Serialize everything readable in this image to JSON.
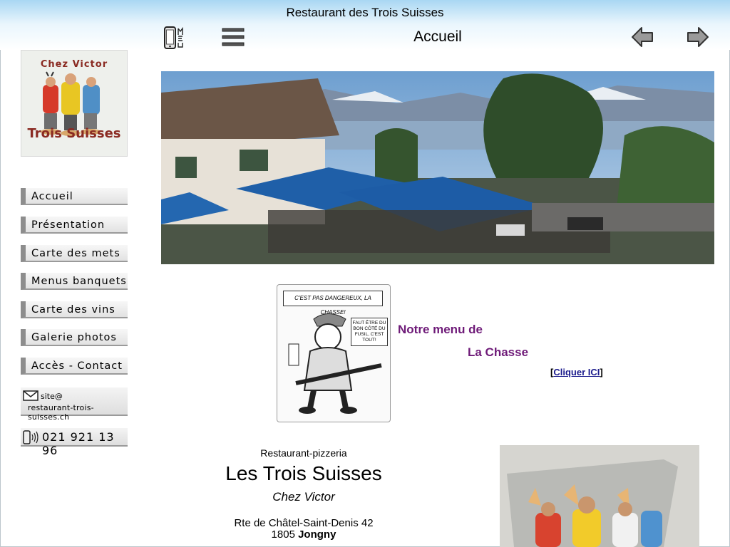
{
  "site_title": "Restaurant des Trois Suisses",
  "toolbar": {
    "page_heading": "Accueil"
  },
  "logo": {
    "line1": "Chez Victor",
    "line2": "Trois Suisses"
  },
  "nav": {
    "items": [
      {
        "label": "Accueil"
      },
      {
        "label": "Présentation"
      },
      {
        "label": "Carte des mets"
      },
      {
        "label": "Menus banquets"
      },
      {
        "label": "Carte des vins"
      },
      {
        "label": "Galerie photos"
      },
      {
        "label": "Accès - Contact"
      }
    ]
  },
  "contact": {
    "mail_line1": "site@",
    "mail_line2": "restaurant-trois-suisses.ch",
    "phone": "021 921 13 96"
  },
  "cartoon": {
    "quote": "C'EST PAS DANGEREUX, LA CHASSE!",
    "bubble": "FAUT ÊTRE DU BON CÔTÉ DU FUSIL, C'EST TOUT!"
  },
  "promo": {
    "line1": "Notre menu de",
    "line2": "La Chasse",
    "link_open": "[",
    "link_label": "Cliquer ICI",
    "link_close": "]"
  },
  "address": {
    "kind": "Restaurant-pizzeria",
    "name": "Les Trois Suisses",
    "subtitle": "Chez Victor",
    "street": "Rte de Châtel-Saint-Denis 42",
    "zip": "1805",
    "city": "Jongny"
  },
  "colors": {
    "accent_purple": "#6e1a78",
    "header_blue": "#a9d7f3",
    "link_blue": "#1a1a8c"
  }
}
